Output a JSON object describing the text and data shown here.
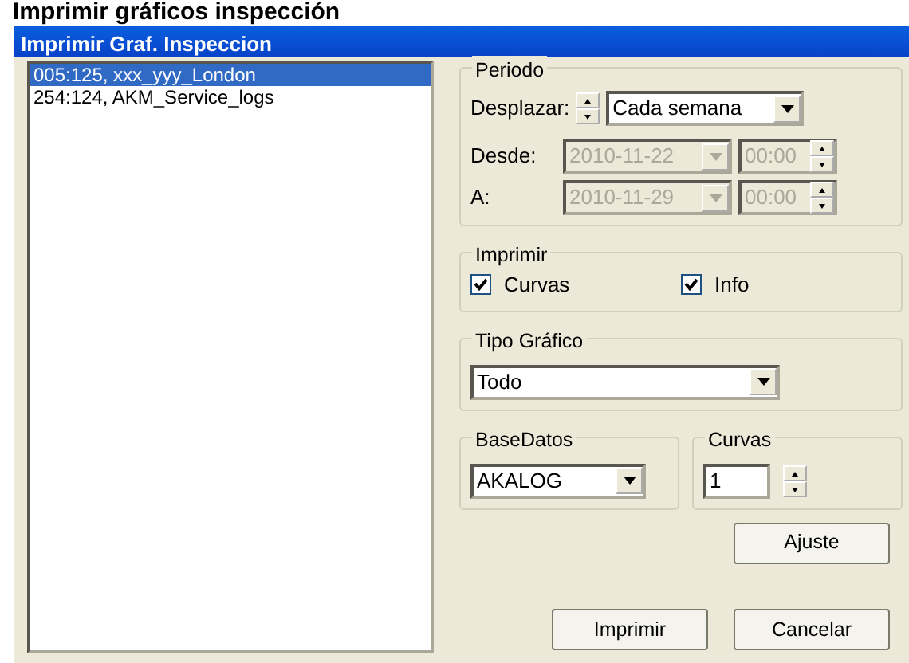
{
  "page_heading": "Imprimir gráficos inspección",
  "window": {
    "title": "Imprimir Graf. Inspeccion"
  },
  "list_items": [
    {
      "text": "005:125, xxx_yyy_London",
      "selected": true
    },
    {
      "text": "254:124, AKM_Service_logs",
      "selected": false
    }
  ],
  "periodo": {
    "title": "Periodo",
    "desplazar_label": "Desplazar:",
    "desplazar_value": "Cada semana",
    "desde_label": "Desde:",
    "desde_date": "2010-11-22",
    "desde_time": "00:00",
    "a_label": "A:",
    "a_date": "2010-11-29",
    "a_time": "00:00",
    "dates_disabled": true
  },
  "imprimir": {
    "title": "Imprimir",
    "options": [
      {
        "label": "Curvas",
        "checked": true
      },
      {
        "label": "Info",
        "checked": true
      }
    ]
  },
  "tipo_grafico": {
    "title": "Tipo Gráfico",
    "value": "Todo"
  },
  "basedatos": {
    "title": "BaseDatos",
    "value": "AKALOG"
  },
  "curvas": {
    "title": "Curvas",
    "value": "1"
  },
  "buttons": [
    {
      "label": "Ajuste"
    },
    {
      "label": "Imprimir"
    },
    {
      "label": "Cancelar"
    }
  ]
}
